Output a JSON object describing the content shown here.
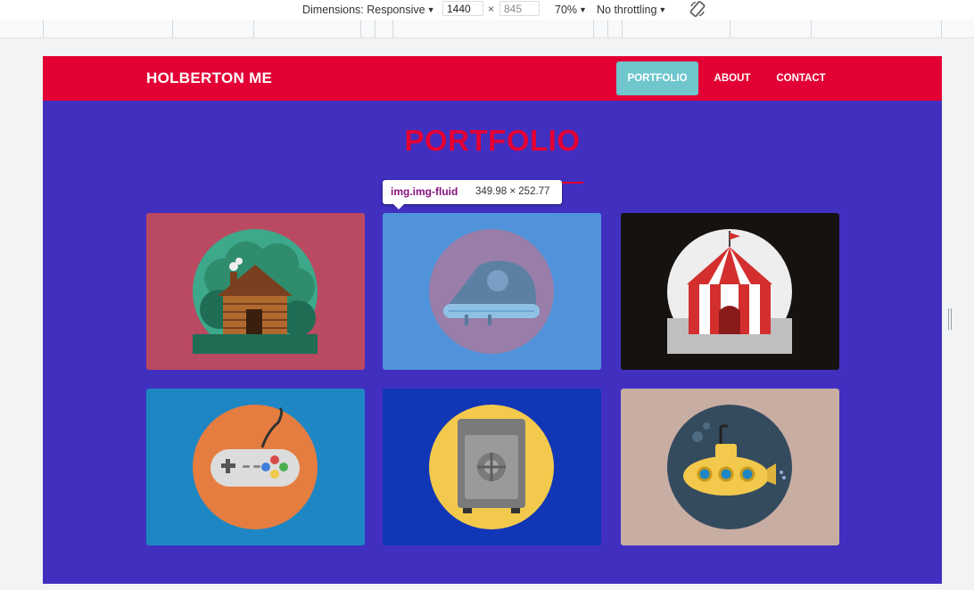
{
  "devtools": {
    "dimensions_label": "Dimensions: Responsive",
    "width_value": "1440",
    "height_placeholder": "845",
    "times": "×",
    "zoom": "70%",
    "throttling": "No throttling",
    "icons": [
      "rotate-icon"
    ]
  },
  "navbar": {
    "brand": "HOLBERTON ME",
    "links": [
      {
        "label": "PORTFOLIO",
        "active": true
      },
      {
        "label": "ABOUT",
        "active": false
      },
      {
        "label": "CONTACT",
        "active": false
      }
    ]
  },
  "section": {
    "title": "PORTFOLIO"
  },
  "tooltip": {
    "selector": "img.img-fluid",
    "size": "349.98 × 252.77"
  },
  "portfolio": {
    "items": [
      {
        "icon": "log-cabin-icon",
        "bg": "#b94a62",
        "circle": "#3da88a"
      },
      {
        "icon": "iron-icon",
        "bg": "#2d7bd8",
        "circle": "#c94d6a"
      },
      {
        "icon": "circus-tent-icon",
        "bg": "#151210",
        "circle": "#eeeeee"
      },
      {
        "icon": "game-controller-icon",
        "bg": "#1f86c4",
        "circle": "#e47d3f"
      },
      {
        "icon": "safe-icon",
        "bg": "#1136b6",
        "circle": "#f2c94c"
      },
      {
        "icon": "submarine-icon",
        "bg": "#c8ada3",
        "circle": "#344b5e"
      }
    ]
  },
  "colors": {
    "navbar": "#e30035",
    "page_bg": "#4130c0",
    "active_nav": "#6fc6cd",
    "accent": "#e30035"
  }
}
